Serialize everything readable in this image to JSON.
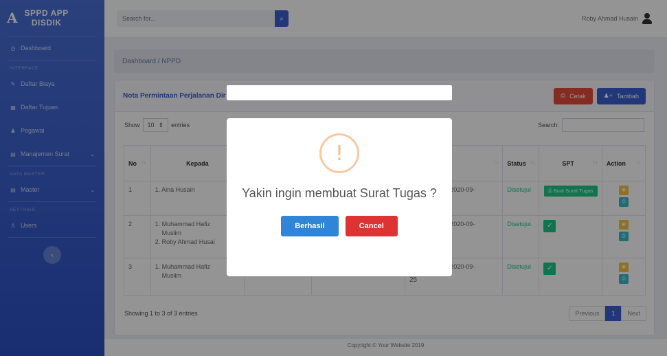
{
  "sidebar": {
    "brand_line1": "SPPD APP",
    "brand_line2": "DISDIK",
    "logo": "A",
    "items": [
      {
        "label": "Dashboard"
      },
      {
        "label": "Daftar Biaya"
      },
      {
        "label": "Daftar Tujuan"
      },
      {
        "label": "Pegawai"
      },
      {
        "label": "Manajemen Surat"
      },
      {
        "label": "Master"
      },
      {
        "label": "Users"
      }
    ],
    "headings": [
      "INTERFACE",
      "DATA MASTER",
      "SETTINGS"
    ]
  },
  "topbar": {
    "search_placeholder": "Search for...",
    "user_name": "Roby Ahmad Husain"
  },
  "breadcrumb": "Dashboard / NPPD",
  "card": {
    "title": "Nota Permintaan Perjalanan Dir",
    "cetak_label": "Cetak",
    "tambah_label": "Tambah",
    "show_label": "Show",
    "entries_value": "10",
    "entries_label": "entries",
    "search_label": "Search:"
  },
  "table": {
    "headers": {
      "no": "No",
      "kepada": "Kepada",
      "tgl": "al",
      "status": "Status",
      "spt": "SPT",
      "action": "Action"
    },
    "rows": [
      {
        "no": "1",
        "kepada1": "1. Aina Husain",
        "kepada2": "",
        "kepada3": "",
        "tgl": "'d 2020-09-",
        "tgl2": "",
        "status": "Disetujui",
        "spt": "Buat Surat Tugas"
      },
      {
        "no": "2",
        "kepada1": "1. Muhammad Hafiz",
        "kepada2": "Muslim",
        "kepada3": "2. Roby Ahmad Husai",
        "tgl": "'d 2020-09-",
        "tgl2": "",
        "status": "Disetujui",
        "spt": "✓"
      },
      {
        "no": "3",
        "kepada1": "1. Muhammad Hafiz",
        "kepada2": "Muslim",
        "kepada3": "",
        "tgl": "'d 2020-09-",
        "tgl2": "25",
        "status": "Disetujui",
        "spt": "✓"
      }
    ]
  },
  "pagination": {
    "info": "Showing 1 to 3 of 3 entries",
    "previous": "Previous",
    "page": "1",
    "next": "Next"
  },
  "footer": "Copyright © Your Website 2019",
  "modal": {
    "icon": "!",
    "message": "Yakin ingin membuat Surat Tugas ?",
    "confirm_label": "Berhasil",
    "cancel_label": "Cancel"
  }
}
